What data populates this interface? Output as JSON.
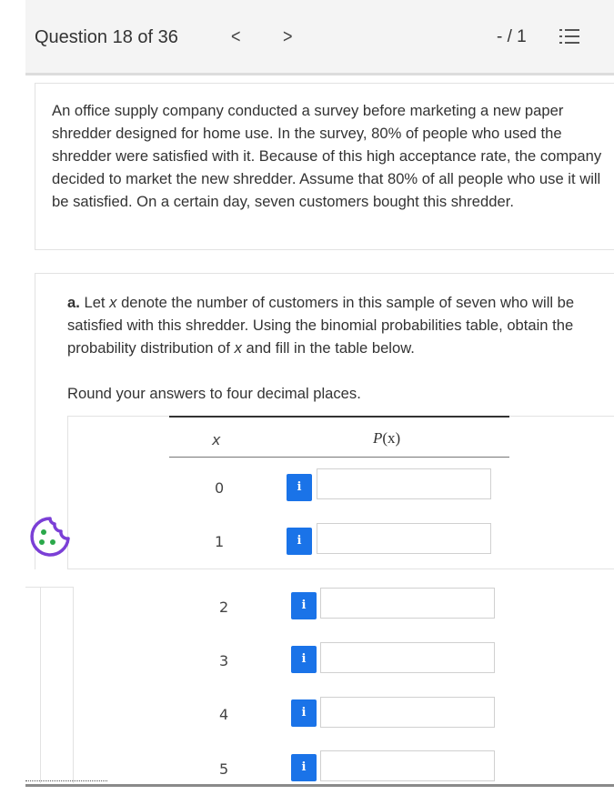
{
  "header": {
    "title": "Question 18 of 36",
    "prev_icon": "chevron-left-icon",
    "next_icon": "chevron-right-icon",
    "prev_label": "<",
    "next_label": ">",
    "score": "- / 1",
    "list_icon": "question-list-icon"
  },
  "problem": {
    "text": "An office supply company conducted a survey before marketing a new paper shredder designed for home use. In the survey, 80% of people who used the shredder were satisfied with it. Because of this high acceptance rate, the company decided to market the new shredder. Assume that 80% of all people who use it will be satisfied. On a certain day, seven customers bought this shredder."
  },
  "part_a": {
    "label": "a.",
    "text_before_x": "Let ",
    "var": "x",
    "text_mid": " denote the number of customers in this sample of seven who will be satisfied with this shredder. Using the binomial probabilities table, obtain the probability distribution of ",
    "var2": "x",
    "text_end": " and fill in the table below.",
    "round_note": "Round your answers to four decimal places."
  },
  "table": {
    "col_x": "x",
    "col_p_prefix": "P",
    "col_p_var": "(x)",
    "rows": [
      {
        "x": "0",
        "value": ""
      },
      {
        "x": "1",
        "value": ""
      },
      {
        "x": "2",
        "value": ""
      },
      {
        "x": "3",
        "value": ""
      },
      {
        "x": "4",
        "value": ""
      },
      {
        "x": "5",
        "value": ""
      }
    ],
    "info_label": "i"
  },
  "colors": {
    "accent": "#1a73e8",
    "cookie": "#7b3fd6"
  },
  "cookie_icon": "cookie-settings-icon"
}
